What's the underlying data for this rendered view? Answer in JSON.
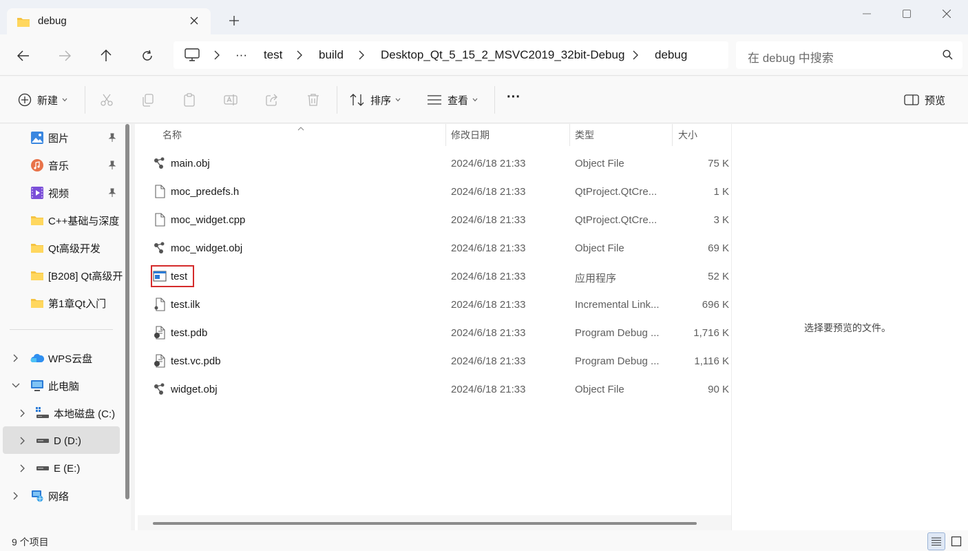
{
  "window": {
    "tab_title": "debug"
  },
  "address": {
    "overflow": "···",
    "crumbs": [
      "test",
      "build",
      "Desktop_Qt_5_15_2_MSVC2019_32bit-Debug",
      "debug"
    ]
  },
  "search": {
    "placeholder": "在 debug 中搜索"
  },
  "commands": {
    "new_label": "新建",
    "sort_label": "排序",
    "view_label": "查看",
    "more_label": "···",
    "preview_label": "预览"
  },
  "sidebar": {
    "quick_access": [
      {
        "label": "图片",
        "icon": "pictures-icon"
      },
      {
        "label": "音乐",
        "icon": "music-icon"
      },
      {
        "label": "视频",
        "icon": "videos-icon"
      }
    ],
    "folders": [
      {
        "label": "C++基础与深度"
      },
      {
        "label": "Qt高级开发"
      },
      {
        "label": "[B208] Qt高级开"
      },
      {
        "label": "第1章Qt入门"
      }
    ],
    "wps": "WPS云盘",
    "this_pc": "此电脑",
    "drives": [
      {
        "label": "本地磁盘 (C:)"
      },
      {
        "label": "D (D:)"
      },
      {
        "label": "E (E:)"
      }
    ],
    "network": "网络"
  },
  "columns": {
    "name": "名称",
    "modified": "修改日期",
    "type": "类型",
    "size": "大小"
  },
  "files": [
    {
      "name": "main.obj",
      "modified": "2024/6/18 21:33",
      "type": "Object File",
      "size": "75 K",
      "icon": "object-file-icon"
    },
    {
      "name": "moc_predefs.h",
      "modified": "2024/6/18 21:33",
      "type": "QtProject.QtCre...",
      "size": "1 K",
      "icon": "document-icon"
    },
    {
      "name": "moc_widget.cpp",
      "modified": "2024/6/18 21:33",
      "type": "QtProject.QtCre...",
      "size": "3 K",
      "icon": "document-icon"
    },
    {
      "name": "moc_widget.obj",
      "modified": "2024/6/18 21:33",
      "type": "Object File",
      "size": "69 K",
      "icon": "object-file-icon"
    },
    {
      "name": "test",
      "modified": "2024/6/18 21:33",
      "type": "应用程序",
      "size": "52 K",
      "icon": "application-icon"
    },
    {
      "name": "test.ilk",
      "modified": "2024/6/18 21:33",
      "type": "Incremental Link...",
      "size": "696 K",
      "icon": "linker-file-icon"
    },
    {
      "name": "test.pdb",
      "modified": "2024/6/18 21:33",
      "type": "Program Debug ...",
      "size": "1,716 K",
      "icon": "debug-file-icon"
    },
    {
      "name": "test.vc.pdb",
      "modified": "2024/6/18 21:33",
      "type": "Program Debug ...",
      "size": "1,116 K",
      "icon": "debug-file-icon"
    },
    {
      "name": "widget.obj",
      "modified": "2024/6/18 21:33",
      "type": "Object File",
      "size": "90 K",
      "icon": "object-file-icon"
    }
  ],
  "preview": {
    "message": "选择要预览的文件。"
  },
  "status": {
    "count": "9 个项目"
  }
}
